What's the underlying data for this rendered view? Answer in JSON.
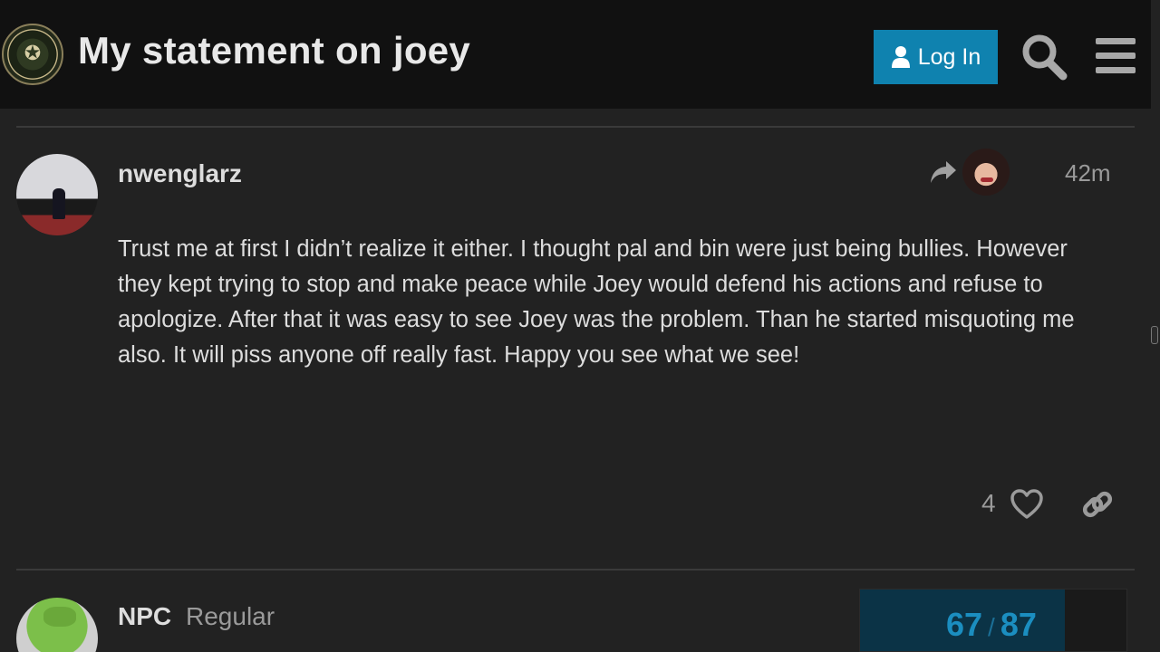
{
  "header": {
    "title": "My statement on joey",
    "login_label": "Log In"
  },
  "posts": [
    {
      "username": "nwenglarz",
      "time": "42m",
      "body": "Trust me at first I didn’t realize it either. I thought pal and bin were just being bullies. However they kept trying to stop and make peace while Joey would defend his actions and refuse to apologize. After that it was easy to see Joey was the problem. Than he started misquoting me also. It will piss anyone off really fast. Happy you see what we see!",
      "likes": "4"
    },
    {
      "username": "NPC",
      "user_title": "Regular"
    }
  ],
  "timeline": {
    "current": "67",
    "separator": "/",
    "total": "87",
    "progress_fraction": 0.77
  },
  "colors": {
    "accent": "#0f82af",
    "header_bg": "#111111",
    "page_bg": "#222222",
    "timeline_text": "#1b8ec0"
  },
  "icons": [
    "user-icon",
    "search-icon",
    "hamburger-menu-icon",
    "reply-arrow-icon",
    "heart-icon",
    "link-icon"
  ]
}
